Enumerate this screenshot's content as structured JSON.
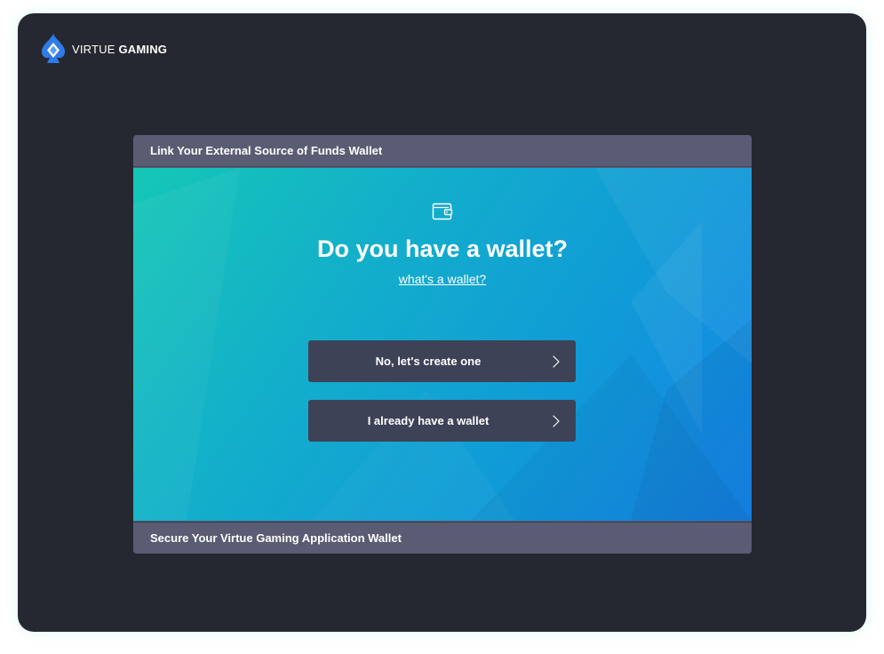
{
  "brand": {
    "name_light": "VIRTUE",
    "name_bold": "GAMING",
    "logo_icon": "spade-diamond-logo-icon",
    "accent": "#2f7be8"
  },
  "panel": {
    "header_title": "Link Your External Source of Funds Wallet",
    "footer_title": "Secure Your Virtue Gaming Application Wallet",
    "icon": "wallet-icon",
    "heading": "Do you have a wallet?",
    "help_link": "what's a wallet?",
    "options": [
      {
        "label": "No, let's create one",
        "icon": "chevron-right-icon"
      },
      {
        "label": "I already have a wallet",
        "icon": "chevron-right-icon"
      }
    ]
  },
  "colors": {
    "background": "#252830",
    "panel_bar": "#5a5c73",
    "button": "#3e4257",
    "gradient_start": "#15c7b6",
    "gradient_end": "#1683ea"
  }
}
